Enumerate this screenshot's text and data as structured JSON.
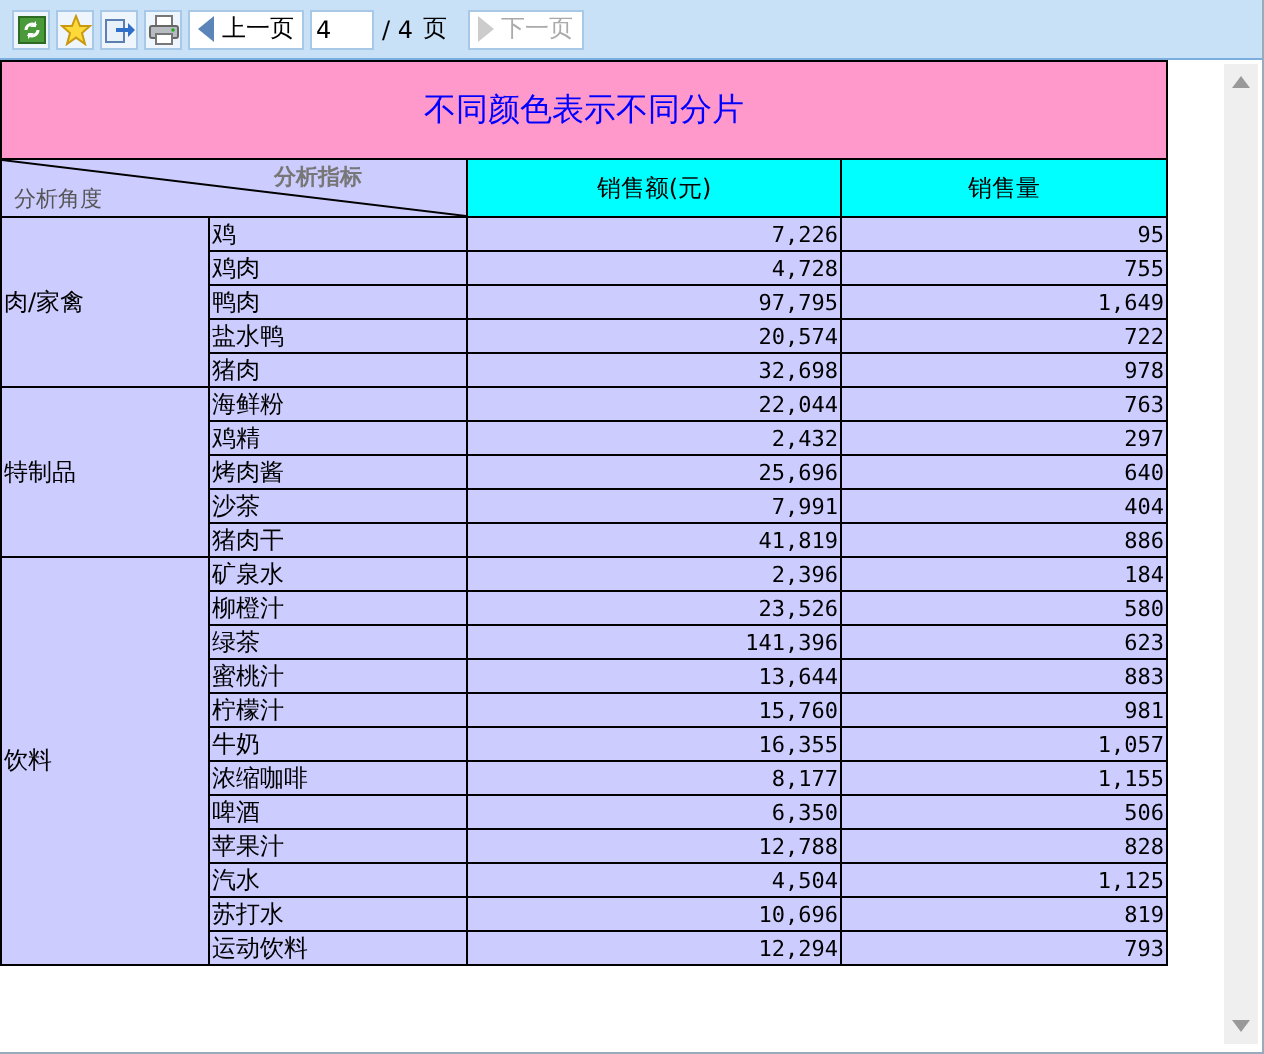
{
  "toolbar": {
    "tools": [
      {
        "kind": "refresh"
      },
      {
        "kind": "favorite"
      },
      {
        "kind": "export"
      },
      {
        "kind": "print"
      }
    ],
    "prev_button": {
      "label": "上一页",
      "disabled": false
    },
    "page_field": {
      "value": "4"
    },
    "page_total": "/ 4",
    "page_unit": "页",
    "next_button": {
      "label": "下一页",
      "disabled": true
    }
  },
  "report": {
    "title": "不同颜色表示不同分片",
    "corner": {
      "top_label": "分析指标",
      "bottom_label": "分析角度"
    },
    "columns": [
      "销售额(元)",
      "销售量"
    ],
    "groups": [
      {
        "name": "肉/家禽",
        "rows": [
          {
            "item": "鸡",
            "sales": "7,226",
            "quantity": "95"
          },
          {
            "item": "鸡肉",
            "sales": "4,728",
            "quantity": "755"
          },
          {
            "item": "鸭肉",
            "sales": "97,795",
            "quantity": "1,649"
          },
          {
            "item": "盐水鸭",
            "sales": "20,574",
            "quantity": "722"
          },
          {
            "item": "猪肉",
            "sales": "32,698",
            "quantity": "978"
          }
        ]
      },
      {
        "name": "特制品",
        "rows": [
          {
            "item": "海鲜粉",
            "sales": "22,044",
            "quantity": "763"
          },
          {
            "item": "鸡精",
            "sales": "2,432",
            "quantity": "297"
          },
          {
            "item": "烤肉酱",
            "sales": "25,696",
            "quantity": "640"
          },
          {
            "item": "沙茶",
            "sales": "7,991",
            "quantity": "404"
          },
          {
            "item": "猪肉干",
            "sales": "41,819",
            "quantity": "886"
          }
        ]
      },
      {
        "name": "饮料",
        "rows": [
          {
            "item": "矿泉水",
            "sales": "2,396",
            "quantity": "184"
          },
          {
            "item": "柳橙汁",
            "sales": "23,526",
            "quantity": "580"
          },
          {
            "item": "绿茶",
            "sales": "141,396",
            "quantity": "623"
          },
          {
            "item": "蜜桃汁",
            "sales": "13,644",
            "quantity": "883"
          },
          {
            "item": "柠檬汁",
            "sales": "15,760",
            "quantity": "981"
          },
          {
            "item": "牛奶",
            "sales": "16,355",
            "quantity": "1,057"
          },
          {
            "item": "浓缩咖啡",
            "sales": "8,177",
            "quantity": "1,155"
          },
          {
            "item": "啤酒",
            "sales": "6,350",
            "quantity": "506"
          },
          {
            "item": "苹果汁",
            "sales": "12,788",
            "quantity": "828"
          },
          {
            "item": "汽水",
            "sales": "4,504",
            "quantity": "1,125"
          },
          {
            "item": "苏打水",
            "sales": "10,696",
            "quantity": "819"
          },
          {
            "item": "运动饮料",
            "sales": "12,294",
            "quantity": "793"
          }
        ]
      }
    ]
  }
}
